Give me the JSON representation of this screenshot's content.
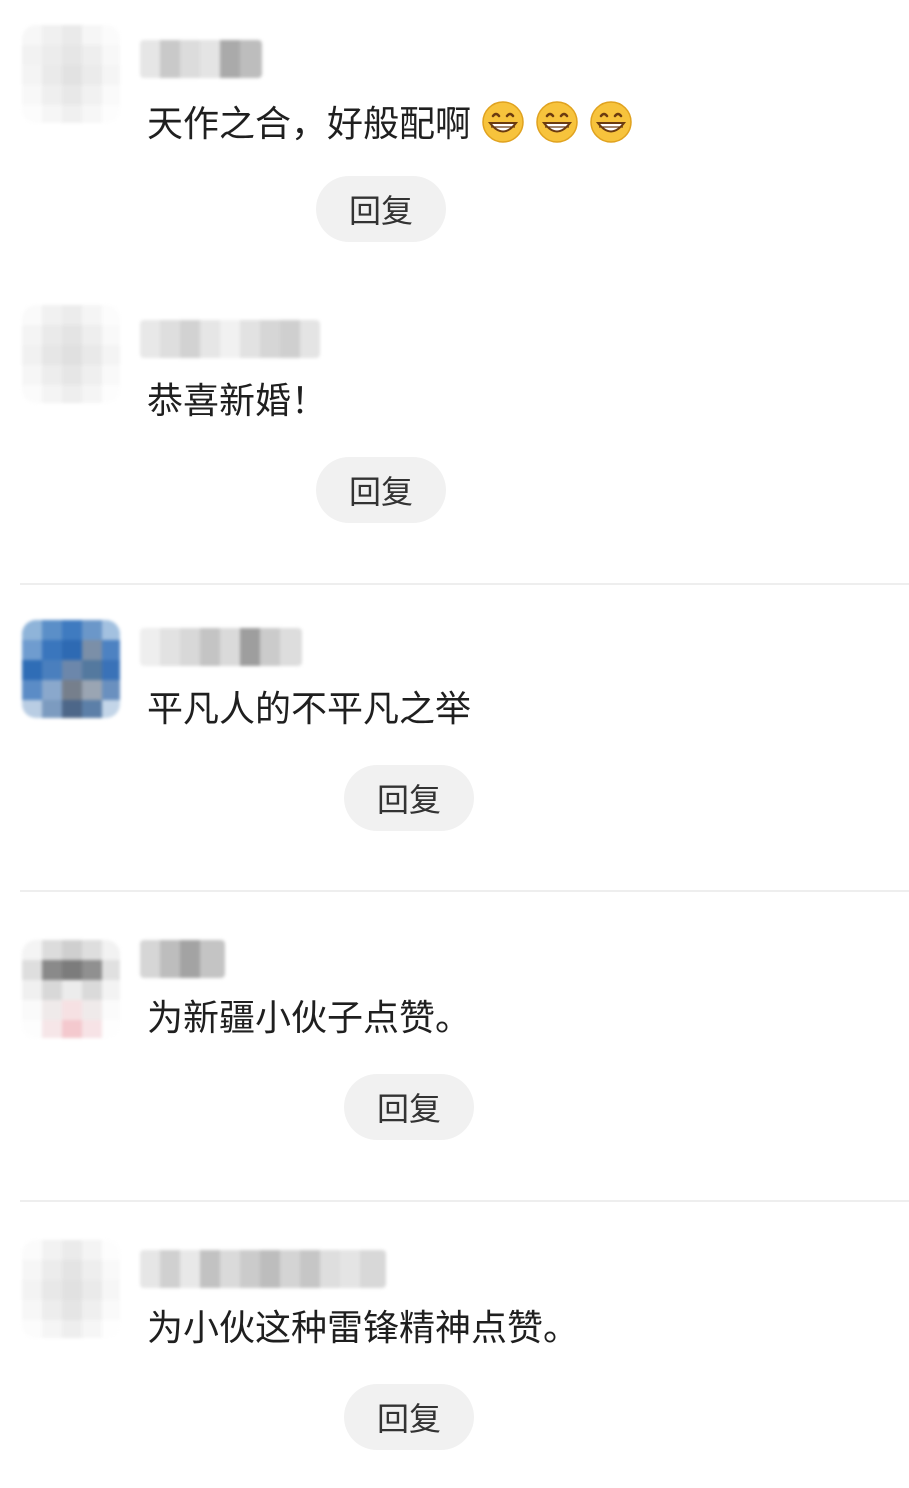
{
  "comments": [
    {
      "text": "天作之合，好般配啊",
      "emojis": [
        "grinning-face-emoji",
        "grinning-face-emoji",
        "grinning-face-emoji"
      ],
      "reply_label": "回复"
    },
    {
      "text": "恭喜新婚！",
      "reply_label": "回复"
    },
    {
      "text": "平凡人的不平凡之举",
      "reply_label": "回复"
    },
    {
      "text": "为新疆小伙子点赞。",
      "reply_label": "回复"
    },
    {
      "text": "为小伙这种雷锋精神点赞。",
      "reply_label": "回复"
    }
  ],
  "colors": {
    "reply_bg": "#f1f1f1",
    "divider": "#eeeeee",
    "text": "#1f1f1f",
    "emoji_face": "#f7c33c"
  }
}
